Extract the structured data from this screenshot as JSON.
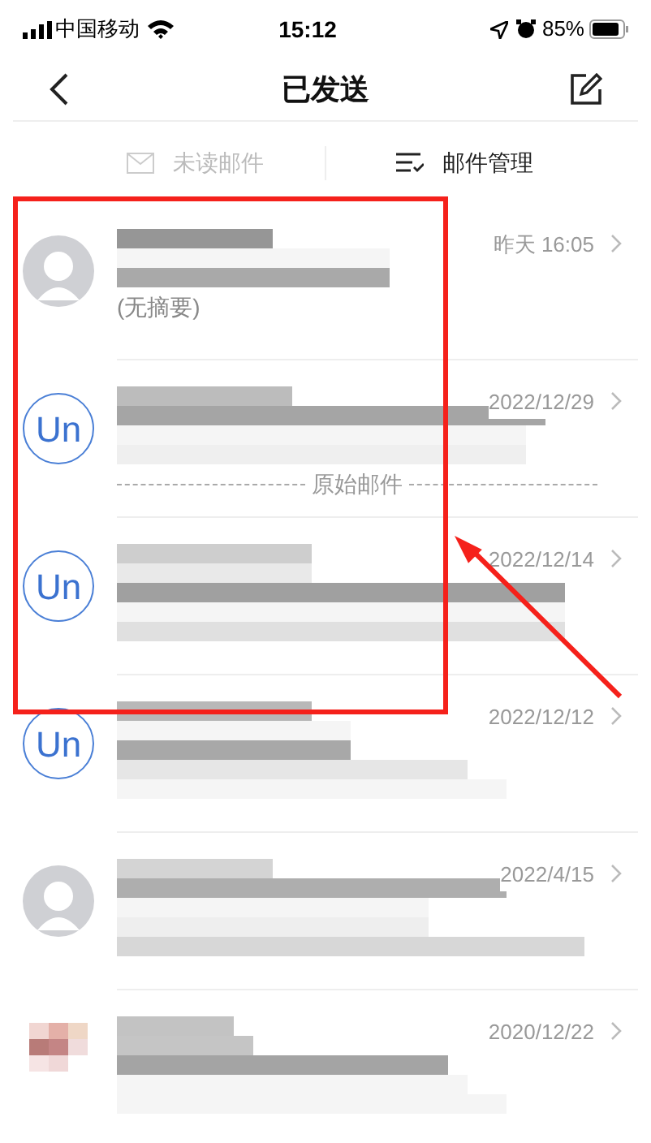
{
  "status_bar": {
    "carrier": "中国移动",
    "time": "15:12",
    "battery": "85%"
  },
  "header": {
    "title": "已发送"
  },
  "toolbar": [
    {
      "label": "未读邮件",
      "disabled": true,
      "kind": "unread"
    },
    {
      "label": "邮件管理",
      "disabled": false,
      "kind": "manage"
    }
  ],
  "messages": [
    {
      "avatar": {
        "kind": "person"
      },
      "date": "昨天 16:05",
      "snippet": "(无摘要)"
    },
    {
      "avatar": {
        "kind": "initials",
        "text": "Un"
      },
      "date": "2022/12/29",
      "divider_label": "原始邮件"
    },
    {
      "avatar": {
        "kind": "initials",
        "text": "Un"
      },
      "date": "2022/12/14"
    },
    {
      "avatar": {
        "kind": "initials",
        "text": "Un"
      },
      "date": "2022/12/12"
    },
    {
      "avatar": {
        "kind": "person"
      },
      "date": "2022/4/15"
    },
    {
      "avatar": {
        "kind": "blurred"
      },
      "date": "2020/12/22"
    }
  ]
}
